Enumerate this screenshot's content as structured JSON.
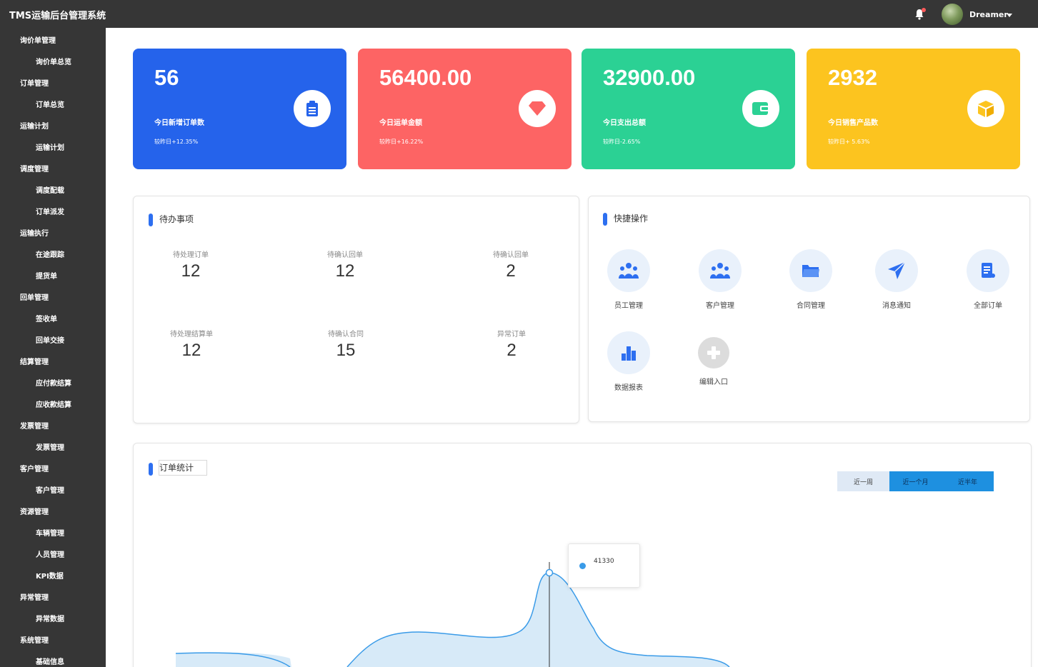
{
  "app": {
    "title": "TMS运输后台管理系统"
  },
  "user": {
    "name": "Dreamer"
  },
  "sidebar": {
    "items": [
      {
        "label": "询价单管理",
        "type": "group"
      },
      {
        "label": "询价单总览",
        "type": "sub"
      },
      {
        "label": "订单管理",
        "type": "group"
      },
      {
        "label": "订单总览",
        "type": "sub"
      },
      {
        "label": "运输计划",
        "type": "group"
      },
      {
        "label": "运输计划",
        "type": "sub"
      },
      {
        "label": "调度管理",
        "type": "group"
      },
      {
        "label": "调度配载",
        "type": "sub"
      },
      {
        "label": "订单派发",
        "type": "sub"
      },
      {
        "label": "运输执行",
        "type": "group"
      },
      {
        "label": "在途跟踪",
        "type": "sub"
      },
      {
        "label": "提货单",
        "type": "sub"
      },
      {
        "label": "回单管理",
        "type": "group"
      },
      {
        "label": "签收单",
        "type": "sub"
      },
      {
        "label": "回单交接",
        "type": "sub"
      },
      {
        "label": "结算管理",
        "type": "group"
      },
      {
        "label": "应付款结算",
        "type": "sub"
      },
      {
        "label": "应收款结算",
        "type": "sub"
      },
      {
        "label": "发票管理",
        "type": "group"
      },
      {
        "label": "发票管理",
        "type": "sub"
      },
      {
        "label": "客户管理",
        "type": "group"
      },
      {
        "label": "客户管理",
        "type": "sub"
      },
      {
        "label": "资源管理",
        "type": "group"
      },
      {
        "label": "车辆管理",
        "type": "sub"
      },
      {
        "label": "人员管理",
        "type": "sub"
      },
      {
        "label": "KPI数据",
        "type": "sub"
      },
      {
        "label": "异常管理",
        "type": "group"
      },
      {
        "label": "异常数据",
        "type": "sub"
      },
      {
        "label": "系统管理",
        "type": "group"
      },
      {
        "label": "基础信息",
        "type": "sub"
      }
    ]
  },
  "stats": [
    {
      "value": "56",
      "label": "今日新增订单数",
      "compare": "较昨日+12.35%",
      "color": "#2563eb",
      "icon": "clipboard-icon"
    },
    {
      "value": "56400.00",
      "label": "今日运单金额",
      "compare": "较昨日+16.22%",
      "color": "#fd6464",
      "icon": "diamond-icon"
    },
    {
      "value": "32900.00",
      "label": "今日支出总额",
      "compare": "较昨日-2.65%",
      "color": "#2bd194",
      "icon": "wallet-icon"
    },
    {
      "value": "2932",
      "label": "今日销售产品数",
      "compare": "较昨日+ 5.63%",
      "color": "#fcc41f",
      "icon": "box-icon"
    }
  ],
  "todo": {
    "title": "待办事项",
    "items": [
      {
        "label": "待处理订单",
        "value": "12"
      },
      {
        "label": "待确认回单",
        "value": "12"
      },
      {
        "label": "待确认回单",
        "value": "2"
      },
      {
        "label": "待处理结算单",
        "value": "12"
      },
      {
        "label": "待确认合同",
        "value": "15"
      },
      {
        "label": "异常订单",
        "value": "2"
      }
    ]
  },
  "quick": {
    "title": "快捷操作",
    "items": [
      {
        "label": "员工管理",
        "icon": "staff-icon"
      },
      {
        "label": "客户管理",
        "icon": "customer-icon"
      },
      {
        "label": "合同管理",
        "icon": "folder-icon"
      },
      {
        "label": "消息通知",
        "icon": "send-icon"
      },
      {
        "label": "全部订单",
        "icon": "document-icon"
      },
      {
        "label": "数据报表",
        "icon": "bar-chart-icon"
      },
      {
        "label": "编辑入口",
        "icon": "add-icon"
      }
    ]
  },
  "orders": {
    "title": "订单统计",
    "ranges": [
      "近一周",
      "近一个月",
      "近半年"
    ],
    "selected_range": "近一个月",
    "tooltip_value": "41330"
  },
  "colors": {
    "accent": "#2d6ff0",
    "series_line": "#3a9be8",
    "series_fill": "#d7eaf8"
  }
}
